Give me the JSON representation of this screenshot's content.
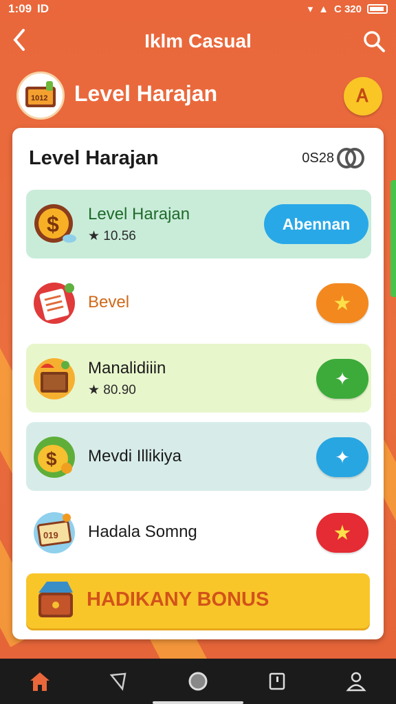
{
  "status_bar": {
    "time": "1:09",
    "carrier_badge": "ID",
    "right_text": "C 320"
  },
  "app_bar": {
    "title": "Iklm Casual",
    "back_glyph": "‹"
  },
  "header": {
    "title": "Level Harajan",
    "coin_glyph": "Ꭺ"
  },
  "card": {
    "title": "Level Harajan",
    "counter": "0S28",
    "rows": [
      {
        "label": "Level Harajan",
        "sub": "★ 10.56",
        "button": "Abennan",
        "bg": "#c9ecd9",
        "btn_color": "#29a8e8",
        "icon": "money-bag-icon"
      },
      {
        "label": "Bevel",
        "sub": "",
        "button": "★",
        "bg": "#ffffff",
        "btn_color": "#f3881f",
        "icon": "clipboard-icon"
      },
      {
        "label": "Manalidiiin",
        "sub": "★ 80.90",
        "button": "✦",
        "bg": "#e8f6cc",
        "btn_color": "#3cab3a",
        "icon": "treasure-box-icon"
      },
      {
        "label": "Mevdi Illikiya",
        "sub": "",
        "button": "✦",
        "bg": "#d7ece9",
        "btn_color": "#28a6e2",
        "icon": "coin-sack-icon"
      },
      {
        "label": "Hadala Somng",
        "sub": "",
        "button": "★",
        "bg": "#ffffff",
        "btn_color": "#e52b33",
        "icon": "ticket-icon"
      }
    ],
    "bonus_label": "HADIKANY BONUS"
  },
  "colors": {
    "bg": "#e8683a",
    "yellow": "#f9c62a",
    "nav": "#1b1b1b"
  }
}
